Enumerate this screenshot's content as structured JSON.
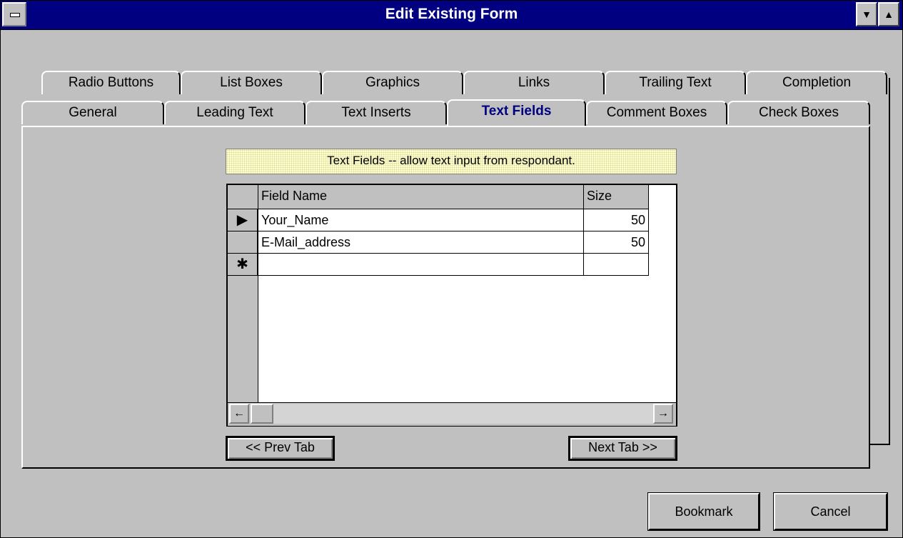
{
  "window": {
    "title": "Edit Existing Form"
  },
  "tabs": {
    "back_row": [
      "Radio Buttons",
      "List Boxes",
      "Graphics",
      "Links",
      "Trailing Text",
      "Completion"
    ],
    "front_row": [
      "General",
      "Leading Text",
      "Text Inserts",
      "Text Fields",
      "Comment Boxes",
      "Check Boxes"
    ],
    "active": "Text Fields"
  },
  "banner": {
    "text": "Text Fields -- allow text input from respondant."
  },
  "grid": {
    "columns": [
      "Field Name",
      "Size"
    ],
    "rows": [
      {
        "selector": "▶",
        "field_name": "Your_Name",
        "size": "50"
      },
      {
        "selector": "",
        "field_name": "E-Mail_address",
        "size": "50"
      },
      {
        "selector": "✱",
        "field_name": "",
        "size": ""
      }
    ]
  },
  "nav": {
    "prev_label": "<< Prev Tab",
    "next_label": "Next Tab >>"
  },
  "footer": {
    "bookmark_label": "Bookmark",
    "cancel_label": "Cancel"
  },
  "colors": {
    "titlebar": "#000080",
    "face": "#c0c0c0",
    "active_tab_text": "#000080",
    "banner": "#ffffc8"
  }
}
